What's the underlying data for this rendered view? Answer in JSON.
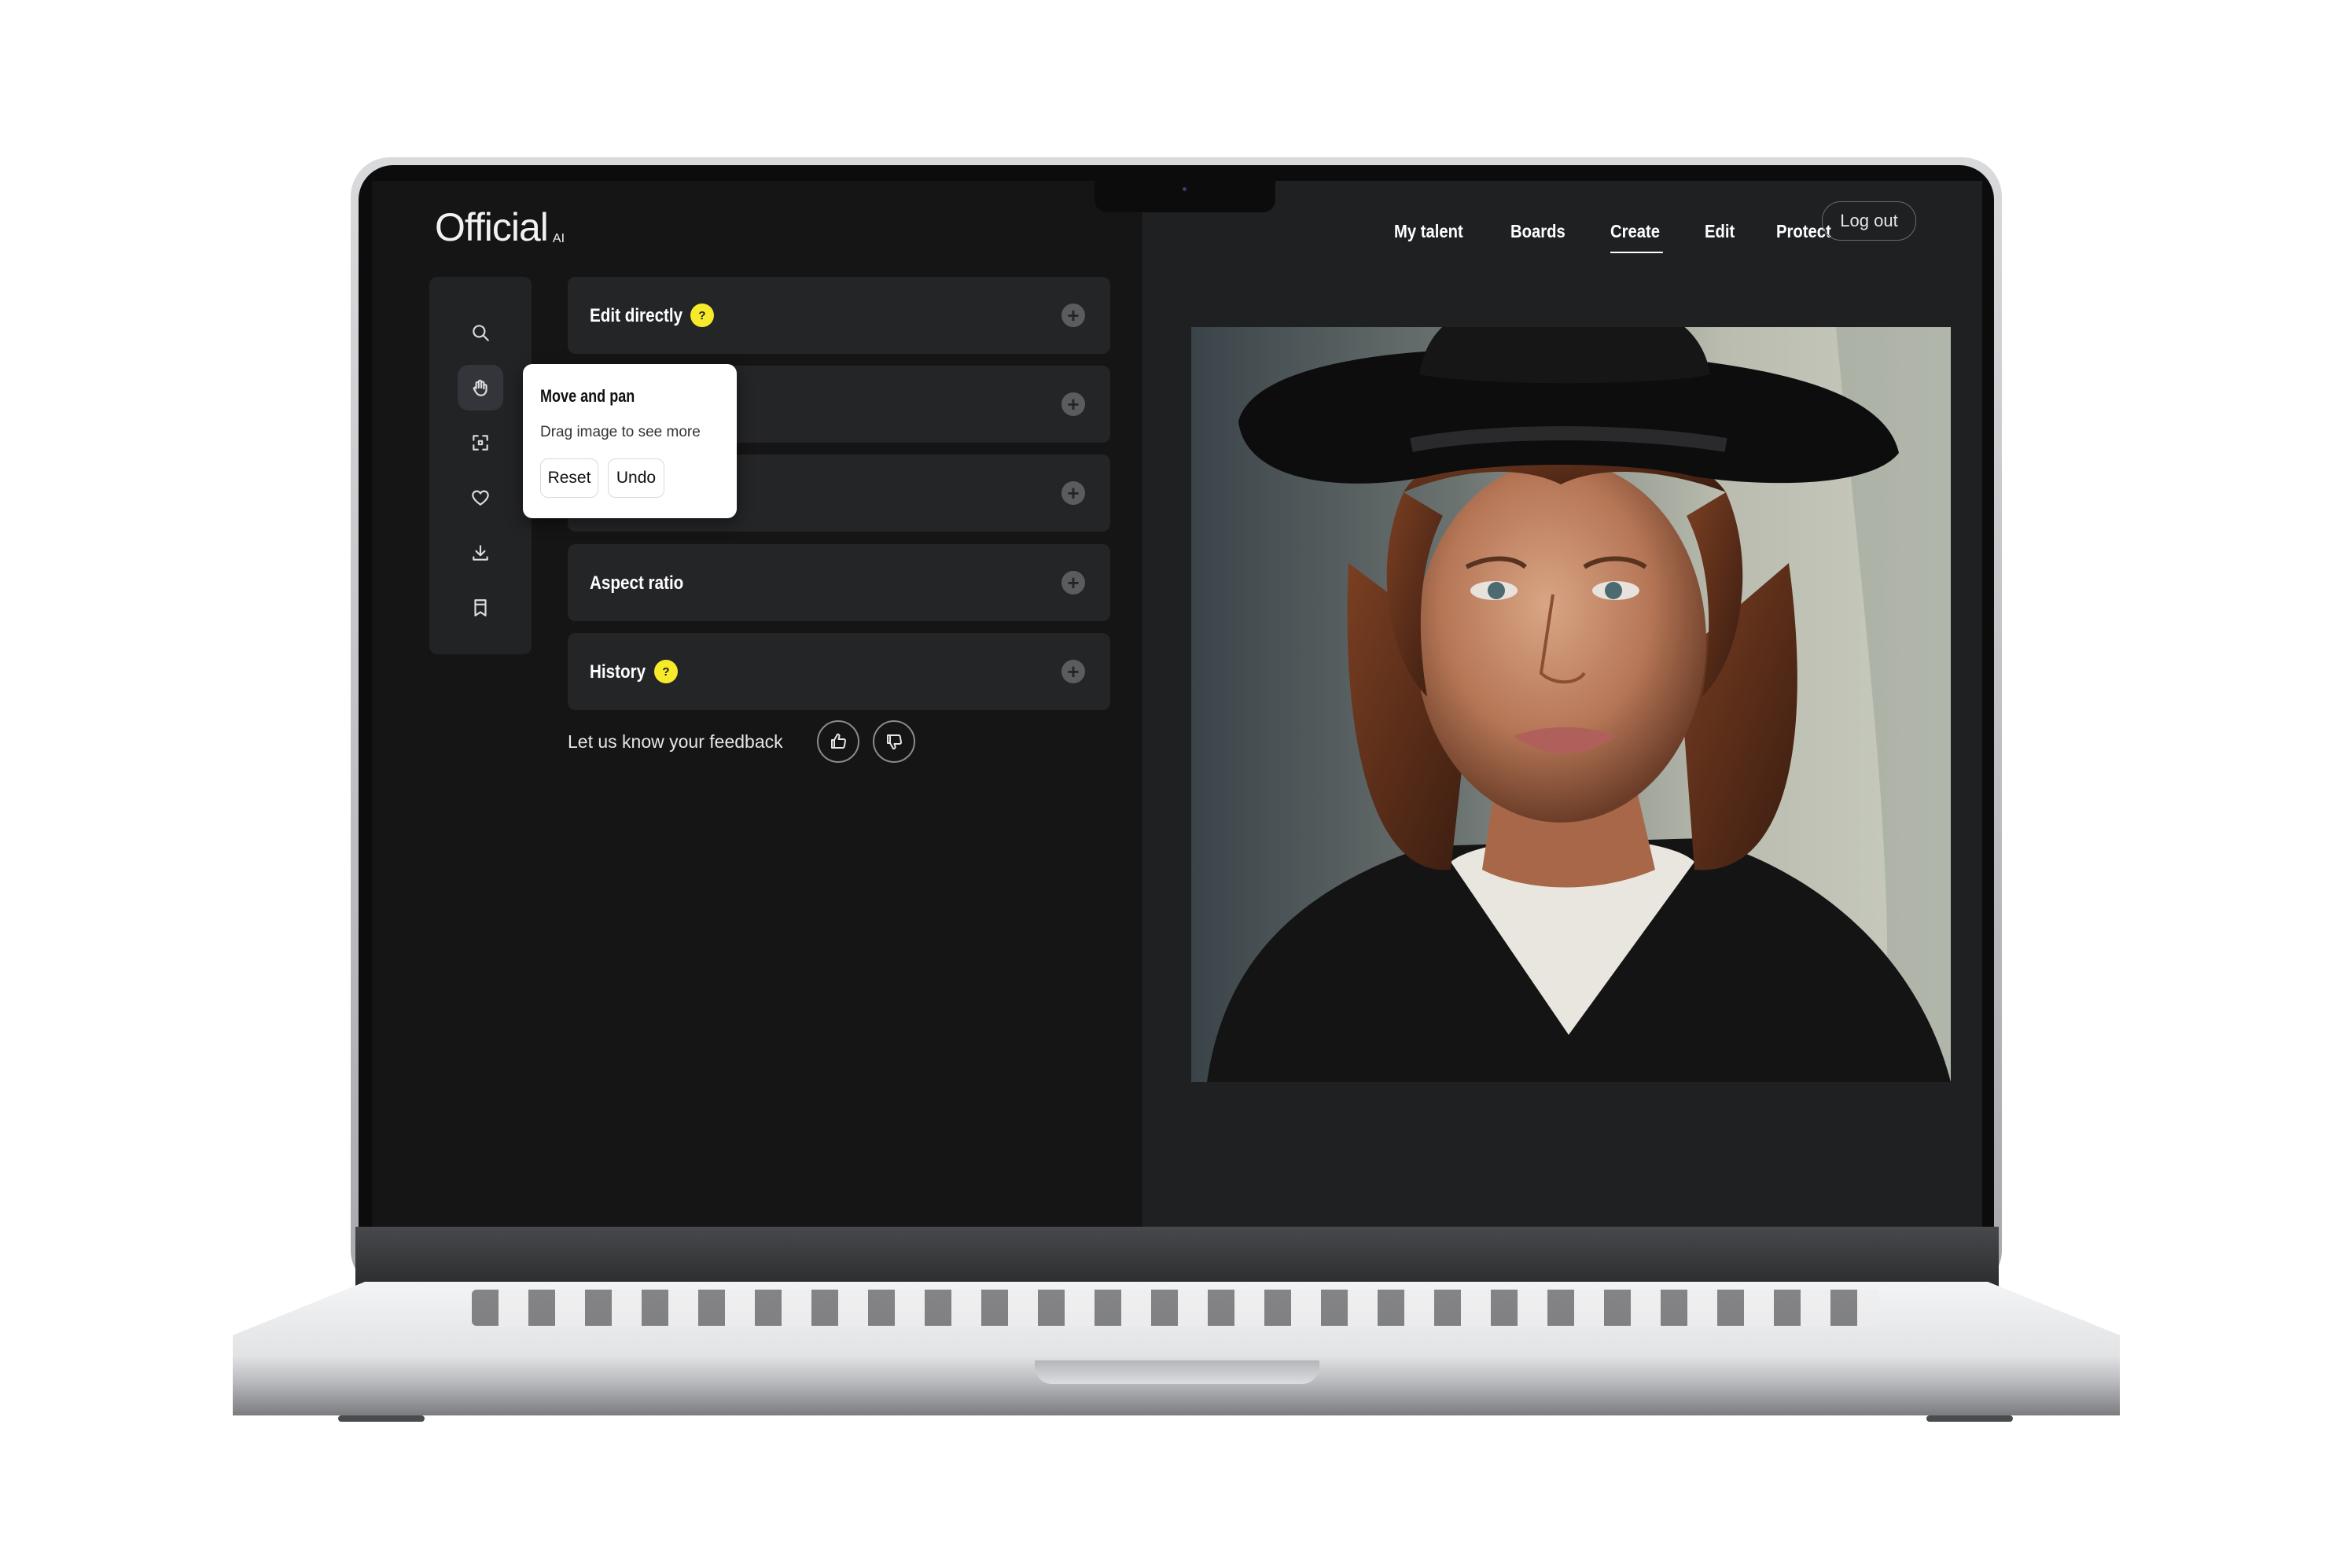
{
  "app": {
    "logo": "Official",
    "logo_sup": "AI"
  },
  "nav": {
    "items": [
      "My talent",
      "Boards",
      "Create",
      "Edit",
      "Protect"
    ],
    "active": "Create",
    "logout": "Log out"
  },
  "toolbar": {
    "tools": [
      "search-icon",
      "hand-icon",
      "select-icon",
      "heart-icon",
      "download-icon",
      "bookmark-icon"
    ],
    "active_tool": "hand-icon"
  },
  "panels": {
    "edit_directly": "Edit directly",
    "aspect_ratio": "Aspect ratio",
    "history": "History",
    "help_glyph": "?"
  },
  "feedback": {
    "prompt": "Let us know your feedback"
  },
  "tooltip": {
    "title": "Move and pan",
    "description": "Drag image to see more",
    "reset": "Reset",
    "undo": "Undo"
  },
  "colors": {
    "accent": "#f7ea2a",
    "screen_bg": "#151516",
    "panel_bg": "#242527",
    "preview_bg": "#1f2022"
  }
}
